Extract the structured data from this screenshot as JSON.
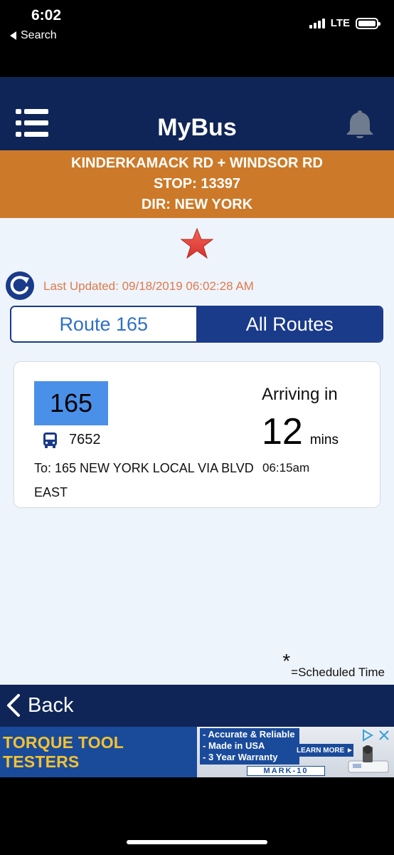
{
  "status_bar": {
    "time": "6:02",
    "back_app": "Search",
    "network": "LTE"
  },
  "header": {
    "title": "MyBus",
    "menu_icon": "list-menu-icon",
    "alert_icon": "bell-icon"
  },
  "stop": {
    "name": "KINDERKAMACK RD + WINDSOR RD",
    "stop_id": "STOP: 13397",
    "direction": "DIR: NEW YORK"
  },
  "favorite": {
    "icon": "star-icon",
    "color": "#e8453c"
  },
  "last_updated": "Last Updated: 09/18/2019 06:02:28 AM",
  "tabs": [
    {
      "label": "Route 165",
      "selected": false
    },
    {
      "label": "All Routes",
      "selected": true
    }
  ],
  "arrivals": [
    {
      "route": "165",
      "vehicle": "7652",
      "destination": "To: 165 NEW YORK LOCAL VIA BLVD EAST",
      "arriving_label": "Arriving in",
      "minutes": "12",
      "minutes_unit": "mins",
      "time": "06:15am"
    }
  ],
  "legend": {
    "symbol": "*",
    "text": "=Scheduled Time"
  },
  "footer": {
    "back_label": "Back"
  },
  "ad": {
    "headline": "TORQUE TOOL TESTERS",
    "bullets": [
      "- Accurate & Reliable",
      "- Made in USA",
      "- 3 Year Warranty"
    ],
    "cta": "LEARN MORE",
    "brand": "MARK-10"
  },
  "colors": {
    "navy": "#0f2557",
    "banner_orange": "#cc7a29",
    "accent_blue": "#1a3a8a",
    "route_badge": "#4a90e8",
    "updated_text": "#e0794d"
  }
}
